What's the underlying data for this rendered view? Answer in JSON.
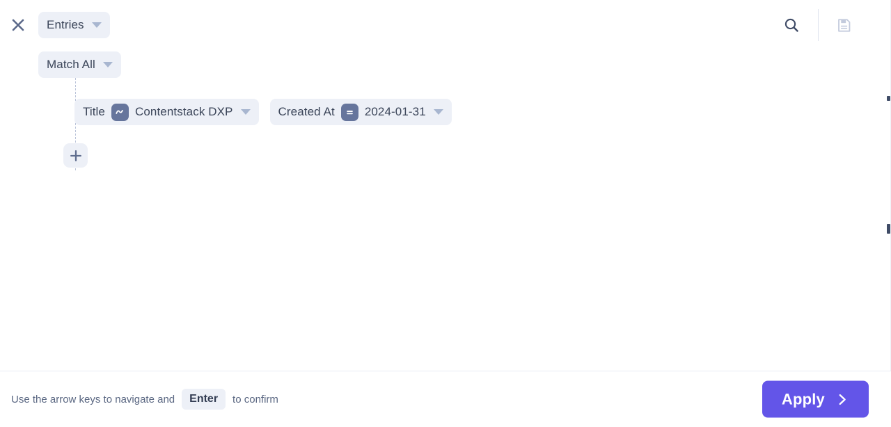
{
  "header": {
    "close_icon": "close-icon",
    "scope_chip": {
      "label": "Entries",
      "caret_icon": "chevron-down-icon"
    },
    "match_chip": {
      "label": "Match All",
      "caret_icon": "chevron-down-icon"
    },
    "search_icon": "search-icon",
    "save_icon": "save-disk-icon"
  },
  "query": {
    "conditions": [
      {
        "field": "Title",
        "operator_symbol": "~",
        "operator_name": "contains",
        "value": "Contentstack DXP",
        "caret_icon": "chevron-down-icon"
      },
      {
        "field": "Created At",
        "operator_symbol": "=",
        "operator_name": "equals",
        "value": "2024-01-31",
        "caret_icon": "chevron-down-icon"
      }
    ],
    "add_condition_icon": "plus-icon"
  },
  "footer": {
    "hint_prefix": "Use the arrow keys to navigate and",
    "hint_key": "Enter",
    "hint_suffix": "to confirm",
    "apply_label": "Apply",
    "apply_chevron_icon": "chevron-right-icon"
  },
  "colors": {
    "accent": "#6355e8",
    "chip_bg": "#edf0f7",
    "badge_bg": "#66759c",
    "text": "#3b4559",
    "caret": "#a8b6d0"
  }
}
